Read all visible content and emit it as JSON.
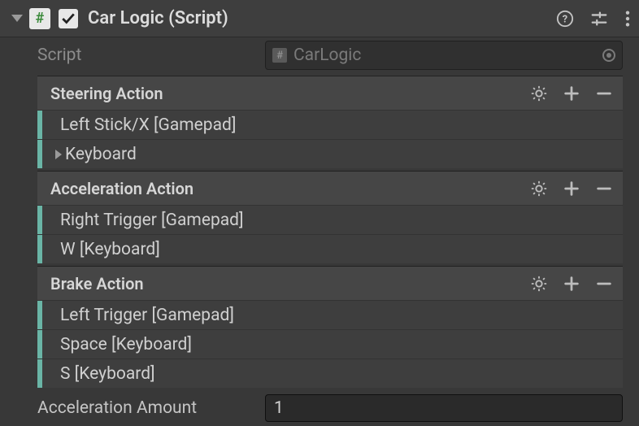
{
  "header": {
    "title": "Car Logic (Script)",
    "enabled": true
  },
  "script_row": {
    "label": "Script",
    "value": "CarLogic"
  },
  "actions": [
    {
      "name": "Steering Action",
      "bindings": [
        {
          "label": "Left Stick/X [Gamepad]",
          "composite": false
        },
        {
          "label": "Keyboard",
          "composite": true
        }
      ]
    },
    {
      "name": "Acceleration Action",
      "bindings": [
        {
          "label": "Right Trigger [Gamepad]",
          "composite": false
        },
        {
          "label": "W [Keyboard]",
          "composite": false
        }
      ]
    },
    {
      "name": "Brake Action",
      "bindings": [
        {
          "label": "Left Trigger [Gamepad]",
          "composite": false
        },
        {
          "label": "Space [Keyboard]",
          "composite": false
        },
        {
          "label": "S [Keyboard]",
          "composite": false
        }
      ]
    }
  ],
  "accel_amount": {
    "label": "Acceleration Amount",
    "value": "1"
  }
}
